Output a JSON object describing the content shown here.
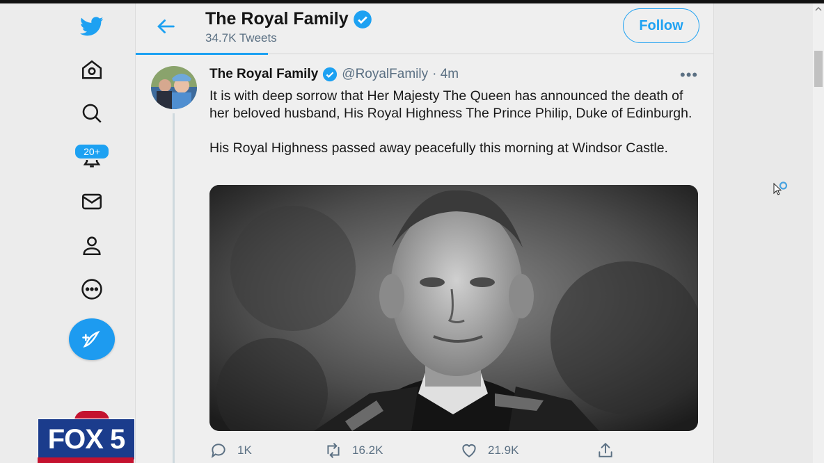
{
  "nav": {
    "notifications_badge": "20+",
    "icons": [
      "twitter-bird-icon",
      "home-icon",
      "search-icon",
      "bell-icon",
      "mail-icon",
      "profile-icon",
      "more-icon",
      "compose-icon"
    ]
  },
  "header": {
    "title": "The Royal Family",
    "tweet_count": "34.7K Tweets",
    "follow_label": "Follow"
  },
  "tweet": {
    "author_name": "The Royal Family",
    "handle": "@RoyalFamily",
    "time": "· 4m",
    "more": "•••",
    "paragraphs": [
      "It is with deep sorrow that Her Majesty The Queen has announced the death of her beloved husband, His Royal Highness The Prince Philip, Duke of Edinburgh.",
      "His Royal Highness passed away peacefully this morning at Windsor Castle."
    ],
    "replies": "1K",
    "retweets": "16.2K",
    "likes": "21.9K"
  },
  "watermark": {
    "logo": "FOX 5"
  },
  "colors": {
    "accent": "#1da1f2",
    "fox_blue": "#1b3c8c",
    "fox_red": "#c4122f"
  }
}
